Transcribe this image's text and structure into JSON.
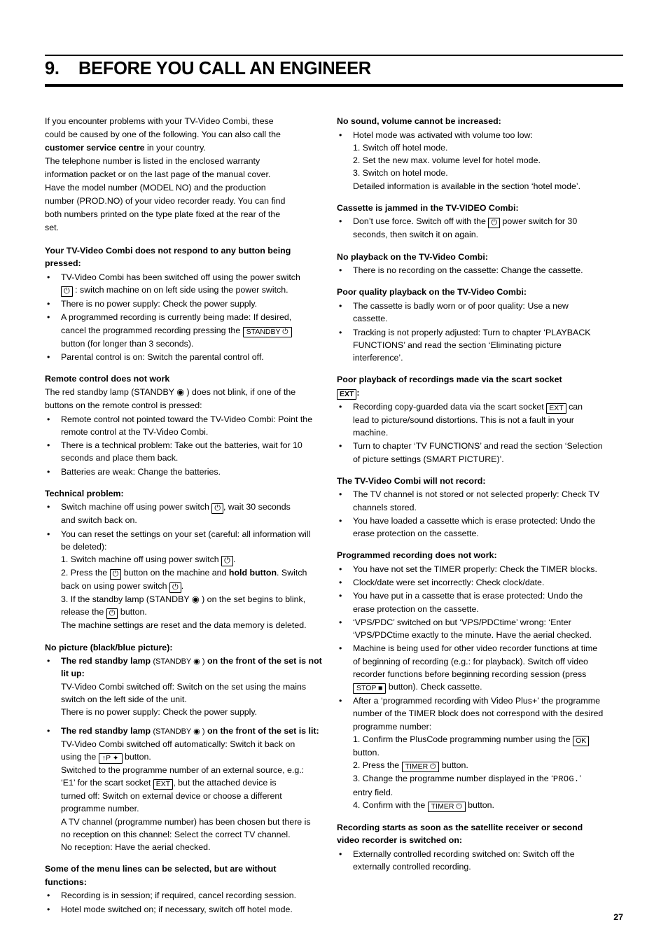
{
  "chapter": {
    "number": "9.",
    "title": "BEFORE YOU CALL AN ENGINEER"
  },
  "page_number": "27",
  "left_column": {
    "intro": {
      "line1": "If you encounter problems with your TV-Video Combi, these",
      "line2": "could be caused by one of the following. You can also call the",
      "line3_bold": "customer service centre",
      "line3_rest": " in your country.",
      "line4": "The telephone number is listed in the enclosed warranty",
      "line5": "information packet or on the last page of the manual cover.",
      "line6": "Have the model number (MODEL NO) and the production",
      "line7": "number (PROD.NO) of your video recorder ready. You can find",
      "line8": "both numbers printed on the type plate fixed at the rear of the",
      "line9": "set."
    },
    "sections": [
      {
        "heading_line1": "Your TV-Video Combi does not respond to any button being",
        "heading_line2": "pressed:",
        "items": [
          {
            "text_a": "TV-Video Combi has been switched off using the power switch",
            "key": "⏻",
            "text_b": ": switch machine on on left side using the power switch."
          },
          {
            "text_a": "There is no power supply: Check the power supply."
          },
          {
            "text_a": "A programmed recording is currently being made: If desired,",
            "text_mid": "cancel the programmed recording pressing the",
            "key": "STANDBY ⏻",
            "text_b": "button (for longer than 3 seconds)."
          },
          {
            "text_a": "Parental control is on: Switch the parental control off."
          }
        ]
      },
      {
        "heading_line1": "Remote control does not work",
        "pre_lines": [
          "The red standby lamp (STANDBY ◉ ) does not blink, if one of the",
          "buttons on the remote control is pressed:"
        ],
        "items": [
          {
            "text_a": "Remote control not pointed toward the TV-Video Combi: Point the",
            "text_b": "remote control at the TV-Video Combi."
          },
          {
            "text_a": "There is a technical problem: Take out the batteries, wait for 10",
            "text_b": "seconds and place them back."
          },
          {
            "text_a": "Batteries are weak: Change the batteries."
          }
        ]
      },
      {
        "heading_line1": "Technical problem:",
        "items": [
          {
            "text_a": "Switch machine off using power switch",
            "key": "⏻",
            "text_b": ", wait 30 seconds",
            "text_c": "and switch back on."
          },
          {
            "text_a": "You can reset the settings on your set (careful: all information will",
            "text_b": "be deleted):"
          }
        ],
        "steps": [
          {
            "pre": "1. Switch machine off using power switch",
            "key": "⏻",
            "post": "."
          },
          {
            "pre": "2. Press the",
            "key": "⏻",
            "mid": "button on the machine and",
            "bold": "hold button",
            "mid2": ". Switch",
            "post": "back on using power switch",
            "key2": "⏻",
            "post2": "."
          },
          {
            "pre": "3. If the standby lamp (STANDBY ◉ ) on the set begins to blink,",
            "post": "release the",
            "key": "⏻",
            "post2": "button."
          },
          {
            "pre": "The machine settings are reset and the data memory is deleted."
          }
        ]
      },
      {
        "heading_line1": "No picture (black/blue picture):",
        "items": [
          {
            "bold_a": "The red standby lamp ",
            "small_a": "(STANDBY ◉ )",
            "bold_b": " on the front of the set is not",
            "bold_c": "lit up:",
            "lines": [
              "TV-Video Combi switched off: Switch on the set using the mains",
              "switch on the left side of the unit.",
              "There is no power supply: Check the power supply."
            ]
          },
          {
            "bold_a": "The red standby lamp ",
            "small_a": "(STANDBY ◉ )",
            "bold_b": " on the front of the set is lit:",
            "lines": [
              "TV-Video Combi switched off automatically: Switch it back on"
            ],
            "key_line_pre": "using the",
            "key": "↑P ✦",
            "key_line_post": "button.",
            "lines2": [
              "Switched to the programme number of an external source, e.g.:"
            ],
            "scart_pre": "‘E1’ for the scart socket",
            "scart_key": "EXT",
            "scart_post": ", but the attached device is",
            "lines3": [
              "turned off: Switch on external device or choose a different",
              "programme number.",
              "A TV channel (programme number) has been chosen but there is",
              "no reception on this channel: Select the correct TV channel.",
              "No reception: Have the aerial checked."
            ]
          }
        ]
      },
      {
        "heading_line1": "Some of the menu lines can be selected, but are without",
        "heading_line2": "functions:",
        "items": [
          {
            "text_a": "Recording is in session; if required, cancel recording session."
          },
          {
            "text_a": "Hotel mode switched on; if necessary, switch off hotel mode."
          }
        ]
      }
    ]
  },
  "right_column": {
    "sections": [
      {
        "heading_line1": "No sound, volume cannot be increased:",
        "items": [
          {
            "text_a": "Hotel mode was activated with volume too low:"
          }
        ],
        "steps": [
          "1. Switch off hotel mode.",
          "2. Set the new max. volume level for hotel mode.",
          "3. Switch on hotel mode.",
          "Detailed information is available in the section ‘hotel mode’."
        ]
      },
      {
        "heading_line1": "Cassette is jammed in the TV-VIDEO Combi:",
        "items": [
          {
            "text_a": "Don’t use force. Switch off with the",
            "key": "⏻",
            "text_b": "power switch for 30",
            "text_c": "seconds, then switch it on again."
          }
        ]
      },
      {
        "heading_line1": "No playback on the TV-Video Combi:",
        "items": [
          {
            "text_a": "There is no recording on the cassette: Change the cassette."
          }
        ]
      },
      {
        "heading_line1": "Poor quality playback on the TV-Video Combi:",
        "items": [
          {
            "text_a": "The cassette is badly worn or of poor quality: Use a new",
            "text_b": "cassette."
          },
          {
            "text_a": "Tracking is not properly adjusted: Turn to chapter ‘PLAYBACK",
            "text_b": "FUNCTIONS’ and read the section ‘Eliminating picture",
            "text_c": "interference’."
          }
        ]
      },
      {
        "heading_line1": "Poor playback of recordings made via the scart socket",
        "heading_key": "EXT",
        "heading_line2": ":",
        "items": [
          {
            "text_a": "Recording copy-guarded data via the scart socket",
            "key": "EXT",
            "text_b": "can",
            "text_c": "lead to picture/sound distortions. This is not a fault in your",
            "text_d": "machine."
          },
          {
            "text_a": "Turn to chapter ‘TV FUNCTIONS’ and read the section ‘Selection",
            "text_b": "of picture settings (SMART PICTURE)’."
          }
        ]
      },
      {
        "heading_line1": "The TV-Video Combi will not record:",
        "items": [
          {
            "text_a": "The TV channel is not stored or not selected properly: Check TV",
            "text_b": "channels stored."
          },
          {
            "text_a": "You have loaded a cassette which is erase protected: Undo the",
            "text_b": "erase protection on the cassette."
          }
        ]
      },
      {
        "heading_line1": "Programmed recording does not work:",
        "items": [
          {
            "text_a": "You have not set the TIMER properly: Check the TIMER blocks."
          },
          {
            "text_a": "Clock/date were set incorrectly: Check clock/date."
          },
          {
            "text_a": "You have put in a cassette that is erase protected: Undo the",
            "text_b": "erase protection on the cassette."
          },
          {
            "text_a": "‘VPS/PDC’ switched on but ‘VPS/PDCtime’ wrong: ‘Enter",
            "text_b": "‘VPS/PDCtime exactly to the minute. Have the aerial checked."
          },
          {
            "text_a": "Machine is being used for other video recorder functions at time",
            "text_b": "of beginning of recording (e.g.: for playback). Switch off video",
            "text_c": "recorder functions before beginning recording session (press",
            "key": "STOP ■",
            "text_d": "button). Check cassette."
          },
          {
            "text_a": "After a ‘programmed recording with Video Plus+’ the programme",
            "text_b": "number of the TIMER block does not correspond with the desired",
            "text_c": "programme number:"
          }
        ],
        "steps": [
          {
            "pre": "1. Confirm the PlusCode programming number using the",
            "key": "OK",
            "post": "button."
          },
          {
            "pre": "2. Press the",
            "key": "TIMER ⏻",
            "post": "button."
          },
          {
            "pre": "3. Change the programme number displayed in the ‘",
            "mono": "PROG.",
            "post": "’",
            "post2": "entry field."
          },
          {
            "pre": "4. Confirm with the",
            "key": "TIMER ⏻",
            "post": "button."
          }
        ]
      },
      {
        "heading_line1": "Recording starts as soon as the satellite receiver or second",
        "heading_line2": "video recorder is switched on:",
        "items": [
          {
            "text_a": "Externally controlled recording switched on: Switch off the",
            "text_b": "externally controlled recording."
          }
        ]
      }
    ]
  }
}
